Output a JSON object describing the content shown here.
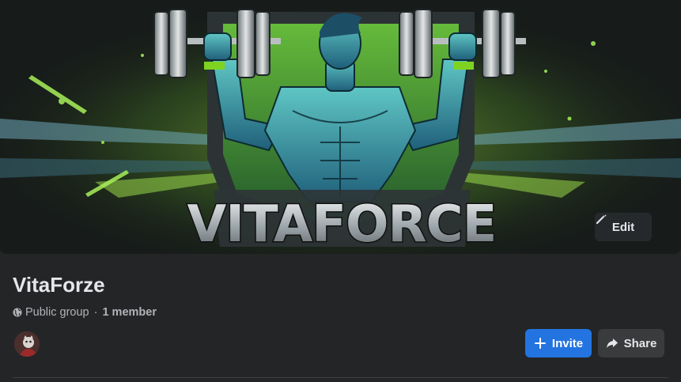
{
  "cover": {
    "brand_text": "VITAFORCE",
    "edit_label": "Edit"
  },
  "group": {
    "name": "VitaForze",
    "privacy": "Public group",
    "separator": "·",
    "members": "1 member"
  },
  "actions": {
    "invite_label": "Invite",
    "share_label": "Share"
  },
  "colors": {
    "background": "#242526",
    "primary_button": "#2374e1",
    "secondary_button": "#3a3b3c",
    "text_primary": "#e4e6eb",
    "text_secondary": "#b0b3b8",
    "accent_green": "#7ed321"
  },
  "icons": {
    "edit": "pencil-icon",
    "privacy": "globe-icon",
    "invite": "plus-icon",
    "share": "share-arrow-icon"
  }
}
